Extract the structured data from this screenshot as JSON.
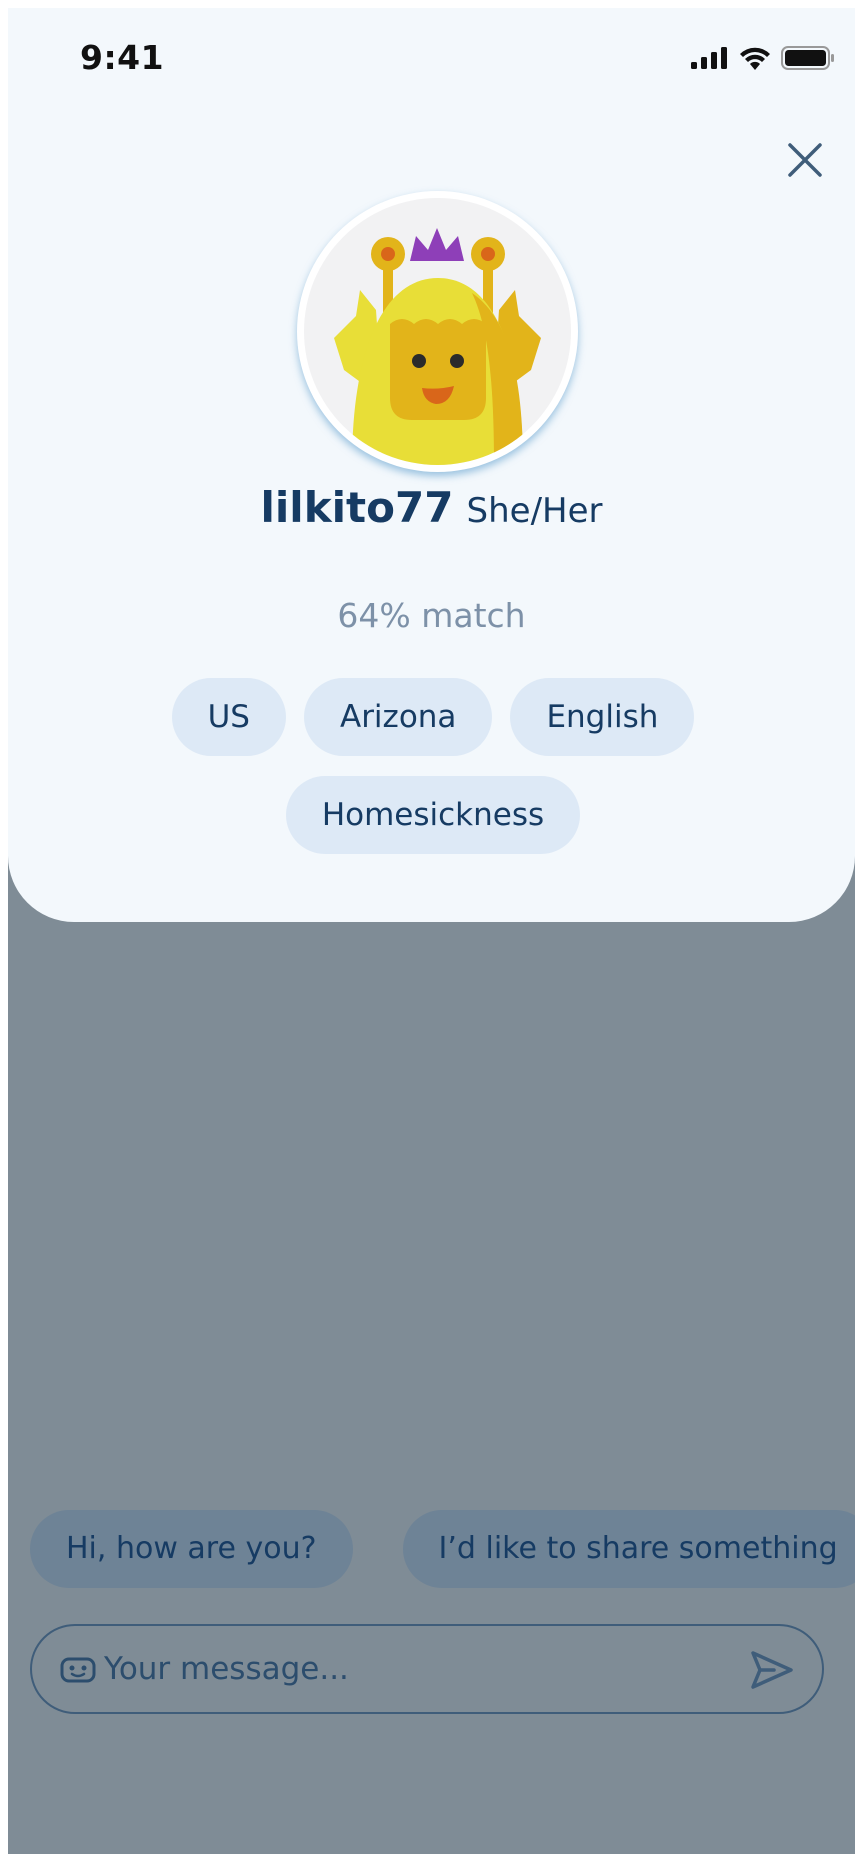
{
  "status_bar": {
    "time": "9:41",
    "icons": [
      "signal-icon",
      "wifi-icon",
      "battery-icon"
    ]
  },
  "profile": {
    "close_icon": "close-icon",
    "avatar_icon": "monster-avatar-icon",
    "username": "lilkito77",
    "pronouns": "She/Her",
    "match": "64% match",
    "tags": [
      "US",
      "Arizona",
      "English",
      "Homesickness"
    ]
  },
  "chat": {
    "quick_replies": [
      "Hi, how are you?",
      "I’d like to share something"
    ],
    "composer": {
      "placeholder": "Your message...",
      "value": "",
      "leading_icon": "robot-face-icon",
      "send_icon": "send-icon"
    }
  },
  "colors": {
    "sheet_background": "#f3f8fc",
    "overlay_background": "#7f8c96",
    "primary_text": "#163b63",
    "muted_text": "#7d91a8",
    "tag_background": "#dde9f6"
  }
}
